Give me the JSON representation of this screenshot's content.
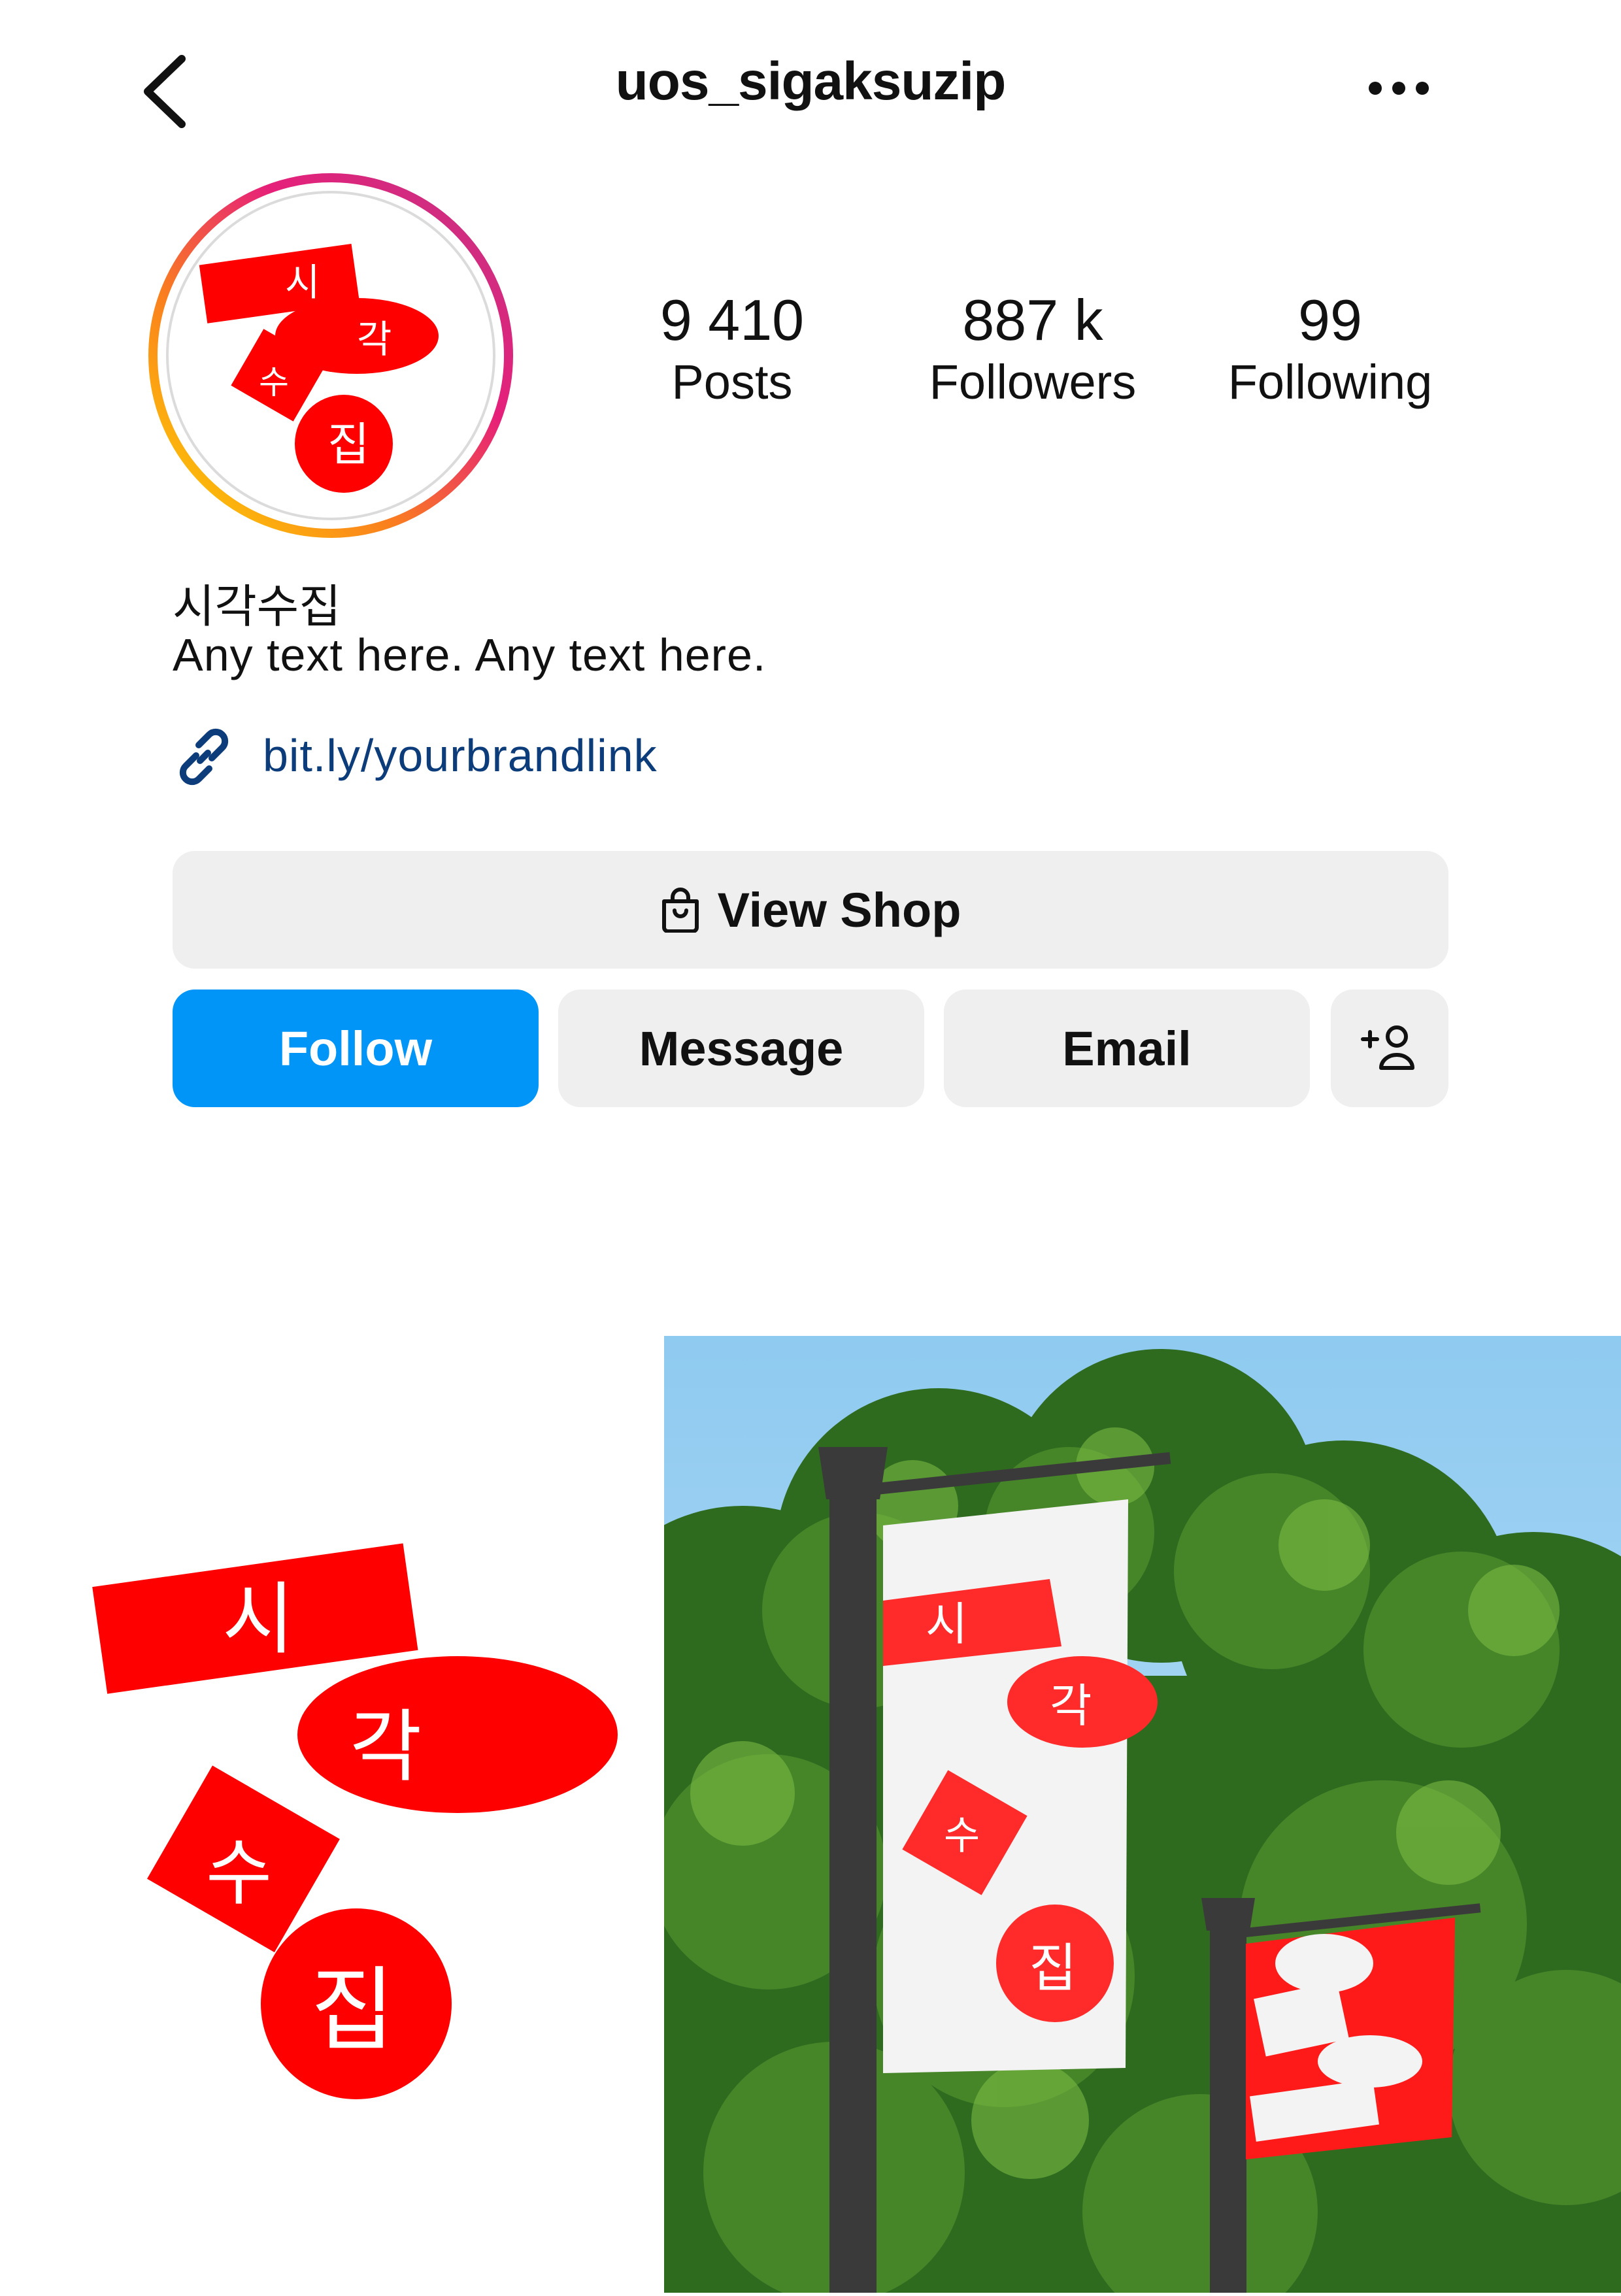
{
  "header": {
    "username": "uos_sigaksuzip",
    "back_icon": "chevron-left-icon",
    "more_icon": "more-horizontal-icon"
  },
  "profile": {
    "avatar_text": [
      "시",
      "각",
      "수",
      "집"
    ],
    "stats": [
      {
        "value": "9 410",
        "label": "Posts"
      },
      {
        "value": "887 k",
        "label": "Followers"
      },
      {
        "value": "99",
        "label": "Following"
      }
    ],
    "name": "시각수집",
    "bio": "Any text here. Any text here.",
    "link": "bit.ly/yourbrandlink"
  },
  "actions": {
    "view_shop": "View Shop",
    "follow": "Follow",
    "message": "Message",
    "email": "Email",
    "add_user_icon": "add-user-icon"
  },
  "colors": {
    "brand_red": "#ff0000",
    "follow_blue": "#0095f6",
    "link_blue": "#0c3c7a",
    "button_gray": "#efefef"
  },
  "posts": {
    "logo_letters": [
      "시",
      "각",
      "수",
      "집"
    ],
    "banner_letters": [
      "시",
      "각",
      "수",
      "집"
    ]
  }
}
